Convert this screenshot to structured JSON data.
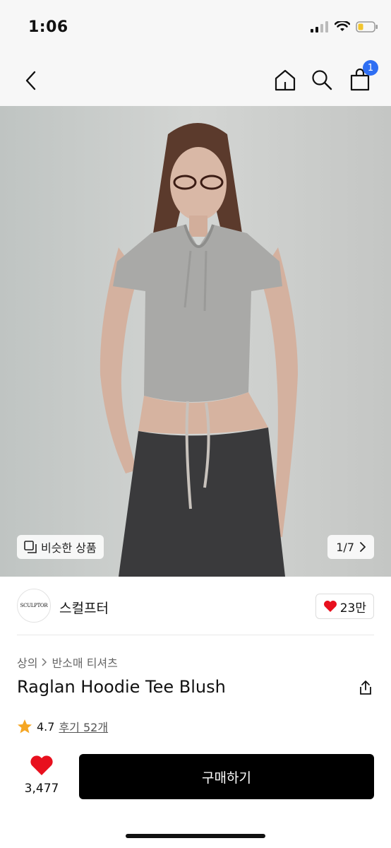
{
  "status": {
    "time": "1:06"
  },
  "gallery": {
    "similar_label": "비슷한 상품",
    "counter": "1/7"
  },
  "brand": {
    "logo_text": "SCULPTOR",
    "name": "스컬프터",
    "likes": "23만"
  },
  "breadcrumb": {
    "level1": "상의",
    "level2": "반소매 티셔츠"
  },
  "product": {
    "title": "Raglan Hoodie Tee Blush",
    "rating": "4.7",
    "reviews": "후기 52개"
  },
  "footer": {
    "like_count": "3,477",
    "buy_label": "구매하기"
  },
  "colors": {
    "accent": "#2f6ff3",
    "heart": "#e8101e",
    "star": "#f5a623"
  }
}
